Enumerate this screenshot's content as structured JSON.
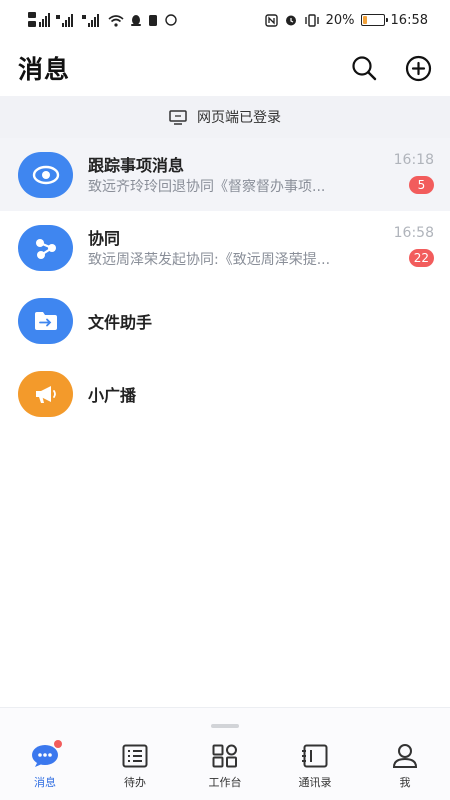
{
  "status_bar": {
    "battery_pct": "20%",
    "time": "16:58",
    "battery_fill": 0.2
  },
  "header": {
    "title": "消息",
    "search_icon": "search-icon",
    "add_icon": "add-circle-icon"
  },
  "web_login": {
    "text": "网页端已登录",
    "icon": "monitor-icon"
  },
  "messages": [
    {
      "title": "跟踪事项消息",
      "preview": "致远齐玲玲回退协同《督察督办事项...",
      "time": "16:18",
      "badge": "5",
      "icon": "eye-target-icon",
      "color": "#3f86f0"
    },
    {
      "title": "协同",
      "preview": "致远周泽荣发起协同:《致远周泽荣提...",
      "time": "16:58",
      "badge": "22",
      "icon": "share-nodes-icon",
      "color": "#3f86f0"
    },
    {
      "title": "文件助手",
      "icon": "file-transfer-icon",
      "color": "#3f86f0"
    },
    {
      "title": "小广播",
      "icon": "megaphone-icon",
      "color": "#f39a2b"
    }
  ],
  "tabs": [
    {
      "label": "消息",
      "icon": "chat-bubble-icon",
      "active": true
    },
    {
      "label": "待办",
      "icon": "todo-list-icon"
    },
    {
      "label": "工作台",
      "icon": "grid-icon"
    },
    {
      "label": "通讯录",
      "icon": "contacts-icon"
    },
    {
      "label": "我",
      "icon": "user-icon"
    }
  ],
  "colors": {
    "accent": "#2f6de1",
    "badge": "#f25c5c",
    "banner_bg": "#f1f2f6"
  }
}
